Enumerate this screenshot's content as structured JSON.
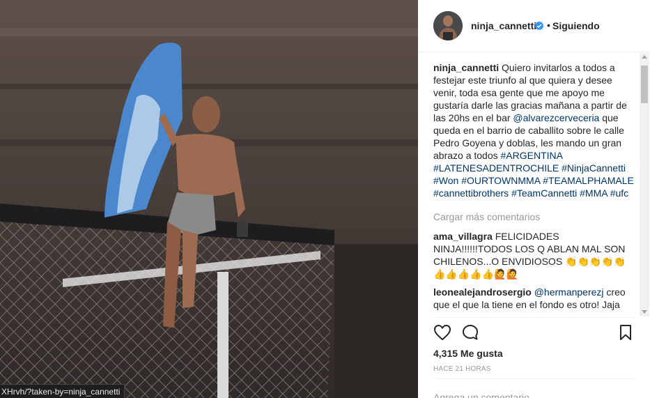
{
  "photo": {
    "alt_scene": "",
    "status_url": "XHrvh/?taken-by=ninja_cannetti"
  },
  "header": {
    "username": "ninja_cannetti",
    "separator": "•",
    "follow_status": "Siguiendo"
  },
  "caption": {
    "username": "ninja_cannetti",
    "text_1": "Quiero invitarlos a todos a festejar este triunfo al que quiera y desee venir, toda esa gente que me apoyo me gustaría darle las gracias mañana a partir de las 20hs en el bar",
    "mention": "@alvarezcerveceria",
    "text_2": "que queda en el barrio de caballito sobre le calle Pedro Goyena y doblas, les mando un gran abrazo a todos",
    "hashtags": [
      "#ARGENTINA",
      "#LATENESADENTROCHILE",
      "#NinjaCannetti",
      "#Won",
      "#OURTOWNMMA",
      "#TEAMALPHAMALE",
      "#cannettibrothers",
      "#TeamCannetti",
      "#MMA",
      "#ufc"
    ]
  },
  "load_more": "Cargar más comentarios",
  "comments": [
    {
      "username": "ama_villagra",
      "text": "FELICIDADES NINJA!!!!!!TODOS LOS Q ABLAN MAL SON CHILENOS...O ENVIDIOSOS 👏👏👏👏👏👍👍👍👍👍🙋🙋"
    },
    {
      "username": "leonealejandrosergio",
      "mention": "@hermanperezj",
      "text": "creo que el que la tiene en el fondo es otro! Jaja"
    }
  ],
  "actions": {
    "like_icon": "heart-icon",
    "comment_icon": "comment-bubble-icon",
    "save_icon": "bookmark-icon"
  },
  "likes": "4,315 Me gusta",
  "timestamp": "HACE 21 HORAS",
  "add_comment_placeholder": "Agrega un comentario...",
  "colors": {
    "link": "#003569",
    "verified": "#3897f0",
    "muted": "#999999",
    "text": "#262626"
  }
}
